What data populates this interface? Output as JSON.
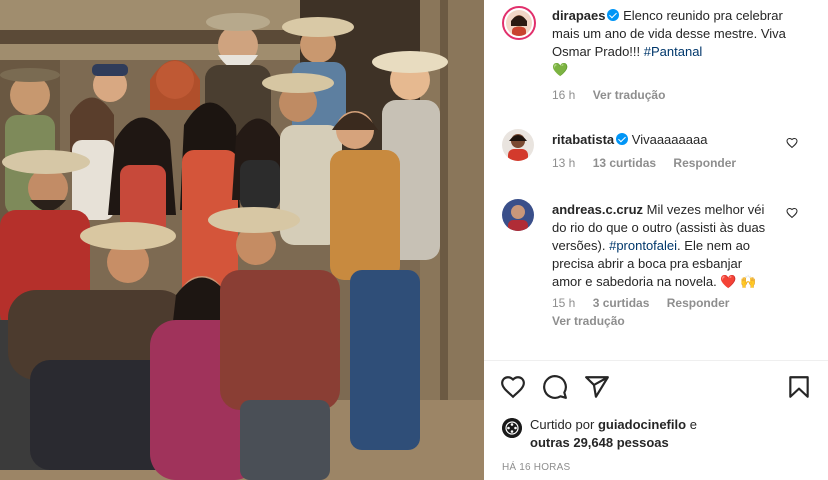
{
  "photo": {
    "alt": "Elenco reunido"
  },
  "post": {
    "author": "dirapaes",
    "caption_text": "Elenco reunido pra celebrar mais um ano de vida desse mestre. Viva Osmar Prado!!!",
    "caption_hashtag": "#Pantanal",
    "caption_emoji": "💚",
    "time": "16 h",
    "translate": "Ver tradução"
  },
  "comments": [
    {
      "username": "ritabatista",
      "text": "Vivaaaaaaaa",
      "time": "13 h",
      "likes": "13 curtidas",
      "reply": "Responder"
    },
    {
      "username": "andreas.c.cruz",
      "text_before": "Mil vezes melhor véi do rio do que o outro (assisti às duas versões).",
      "hashtag": "#prontofalei",
      "text_after": ". Ele nem ao precisa abrir a boca pra esbanjar amor e sabedoria na novela.",
      "emojis": "❤️ 🙌",
      "time": "15 h",
      "likes": "3 curtidas",
      "reply": "Responder",
      "translate": "Ver tradução"
    }
  ],
  "likes": {
    "prefix": "Curtido por",
    "by": "guiadocinefilo",
    "middle": "e",
    "others": "outras 29,648 pessoas"
  },
  "timestamp": "HÁ 16 HORAS",
  "colors": {
    "verified": "#0095f6",
    "hashtag": "#00376b",
    "meta": "#8e8e8e",
    "emoji_heart": "#ed4956"
  },
  "icons": [
    "heart-icon",
    "comment-icon",
    "share-icon",
    "bookmark-icon"
  ]
}
